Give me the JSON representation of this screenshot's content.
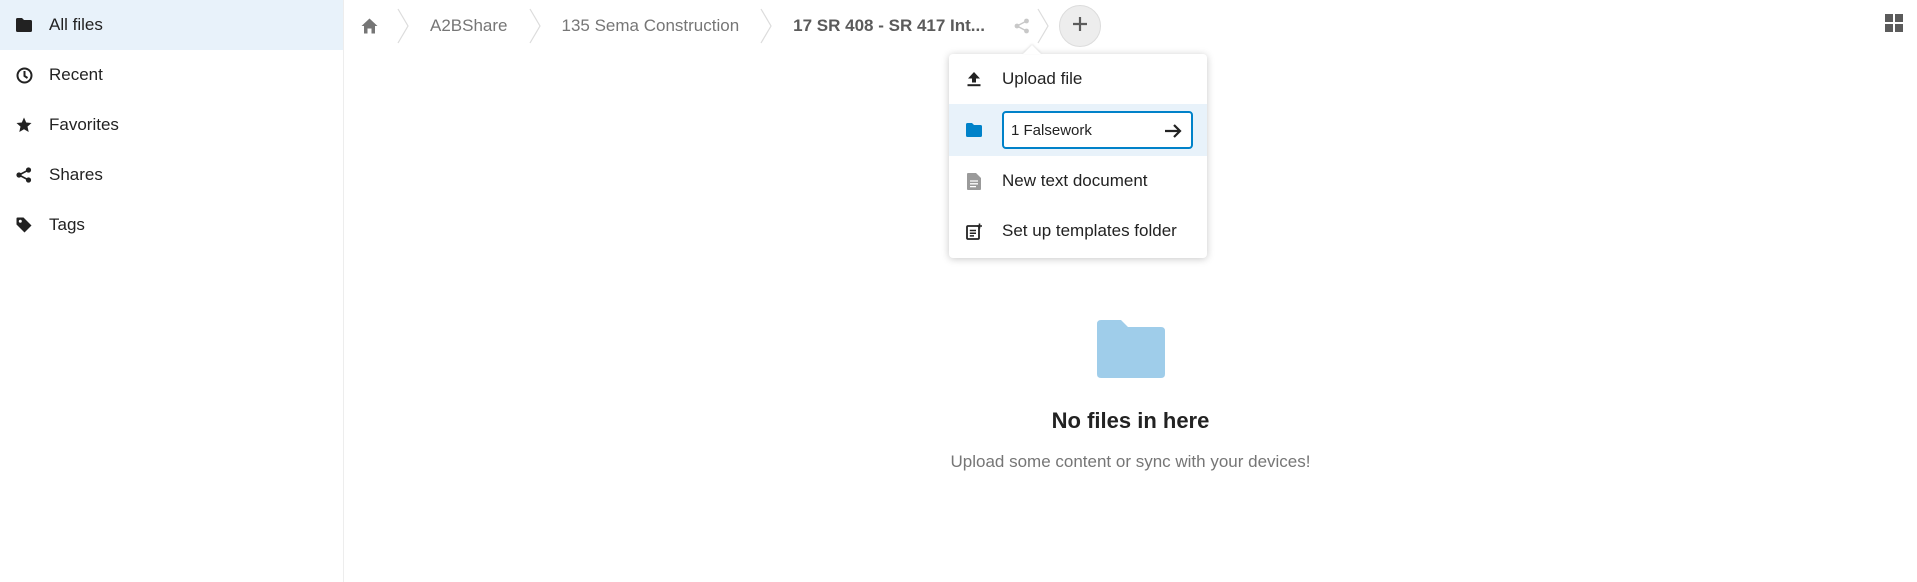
{
  "sidebar": {
    "items": [
      {
        "label": "All files",
        "icon": "folder-icon",
        "active": true
      },
      {
        "label": "Recent",
        "icon": "clock-icon"
      },
      {
        "label": "Favorites",
        "icon": "star-icon"
      },
      {
        "label": "Shares",
        "icon": "share-icon"
      },
      {
        "label": "Tags",
        "icon": "tag-icon"
      }
    ]
  },
  "breadcrumb": {
    "home_icon": "home-icon",
    "items": [
      "A2BShare",
      "135 Sema Construction",
      "17 SR 408 - SR 417 Int..."
    ]
  },
  "new_menu": {
    "upload_label": "Upload file",
    "folder_input_value": "1 Falsework",
    "text_doc_label": "New text document",
    "templates_label": "Set up templates folder"
  },
  "empty_state": {
    "title": "No files in here",
    "subtitle": "Upload some content or sync with your devices!"
  },
  "colors": {
    "accent": "#0082c9",
    "active_bg": "#e8f2fa",
    "empty_folder": "#9fcdea"
  }
}
